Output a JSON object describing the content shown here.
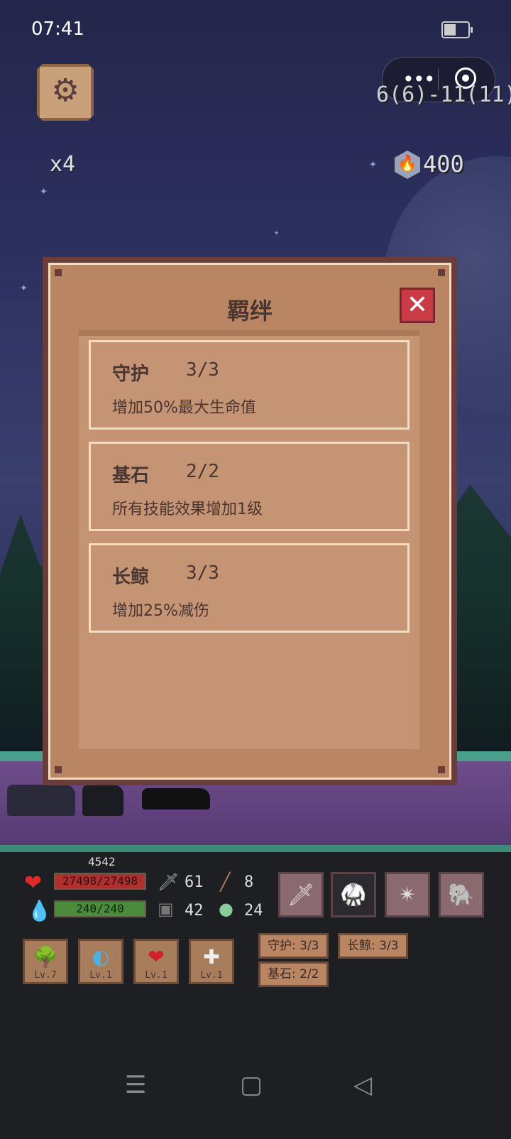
{
  "status_bar": {
    "time": "07:41"
  },
  "hud_top": {
    "stage": "6(6)-11(11)",
    "speed": "x4",
    "gems": "400",
    "icons": {
      "settings": "gear-icon",
      "currency": "fire-gem-icon"
    }
  },
  "modal": {
    "title": "羁绊",
    "close_label": "✕",
    "bonds": [
      {
        "name": "守护",
        "count": "3/3",
        "desc": "增加50%最大生命值"
      },
      {
        "name": "基石",
        "count": "2/2",
        "desc": "所有技能效果增加1级"
      },
      {
        "name": "长鲸",
        "count": "3/3",
        "desc": "增加25%减伤"
      }
    ]
  },
  "player": {
    "score": "4542",
    "hp": "27498/27498",
    "mp": "240/240",
    "attack": "61",
    "magic": "8",
    "defense": "42",
    "resist": "24"
  },
  "equipment": [
    "sword-icon",
    "armor-icon",
    "star-amulet-icon",
    "elephant-icon"
  ],
  "skills": [
    {
      "icon": "tree-icon",
      "level": "Lv.7"
    },
    {
      "icon": "moon-icon",
      "level": "Lv.1"
    },
    {
      "icon": "heart-burst-icon",
      "level": "Lv.1"
    },
    {
      "icon": "plus-icon",
      "level": "Lv.1"
    }
  ],
  "bond_tags": [
    "守护: 3/3",
    "长鲸: 3/3",
    "基石: 2/2"
  ],
  "colors": {
    "hp": "#b03030",
    "mp": "#4a8c3c",
    "modal_frame": "#6b3d3a",
    "modal_fill": "#b98563",
    "close_button": "#c93c46"
  }
}
